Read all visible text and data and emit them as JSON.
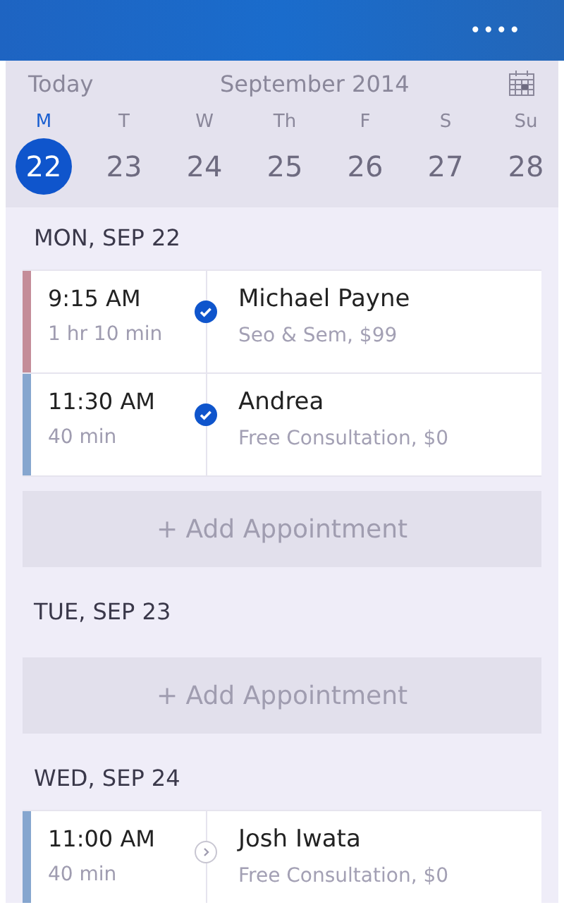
{
  "header": {
    "menu": "••••"
  },
  "calendar": {
    "today": "Today",
    "month": "September 2014",
    "days": [
      {
        "weekday": "M",
        "date": "22",
        "selected": true
      },
      {
        "weekday": "T",
        "date": "23",
        "selected": false
      },
      {
        "weekday": "W",
        "date": "24",
        "selected": false
      },
      {
        "weekday": "Th",
        "date": "25",
        "selected": false
      },
      {
        "weekday": "F",
        "date": "26",
        "selected": false
      },
      {
        "weekday": "S",
        "date": "27",
        "selected": false
      },
      {
        "weekday": "Su",
        "date": "28",
        "selected": false
      }
    ]
  },
  "sections": [
    {
      "title": "MON, SEP 22",
      "add": "+ Add Appointment",
      "appointments": [
        {
          "time": "9:15 AM",
          "duration": "1 hr 10 min",
          "client": "Michael Payne",
          "service": "Seo & Sem, $99",
          "color": "#c48d99",
          "confirmed": true
        },
        {
          "time": "11:30 AM",
          "duration": "40 min",
          "client": "Andrea",
          "service": "Free Consultation, $0",
          "color": "#86a6cf",
          "confirmed": true
        }
      ]
    },
    {
      "title": "TUE, SEP 23",
      "add": "+ Add Appointment"
    },
    {
      "title": "WED, SEP 24",
      "appointments": [
        {
          "time": "11:00 AM",
          "duration": "40 min",
          "client": "Josh Iwata",
          "service": "Free Consultation, $0",
          "color": "#86a6cf",
          "confirmed": false
        }
      ]
    }
  ]
}
